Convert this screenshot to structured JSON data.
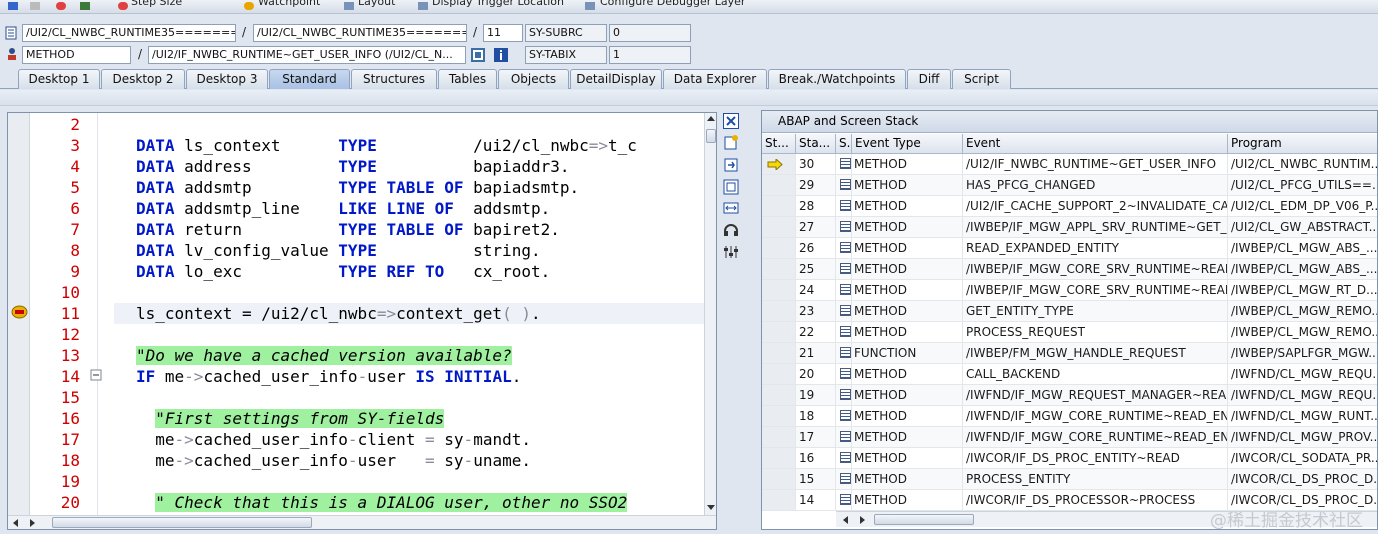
{
  "toolbar": {
    "items": [
      {
        "label": "Step Size"
      },
      {
        "label": "Watchpoint"
      },
      {
        "label": "Layout"
      },
      {
        "label": "Display Trigger Location"
      },
      {
        "label": "Configure Debugger Layer"
      }
    ]
  },
  "fields": {
    "program": "/UI2/CL_NWBC_RUNTIME35=======",
    "include": "/UI2/CL_NWBC_RUNTIME35=======",
    "line": "11",
    "sy_subrc_label": "SY-SUBRC",
    "sy_subrc_value": "0",
    "event_type": "METHOD",
    "event": "/UI2/IF_NWBC_RUNTIME~GET_USER_INFO (/UI2/CL_N...",
    "sy_tabix_label": "SY-TABIX",
    "sy_tabix_value": "1",
    "slash": "/"
  },
  "tabs": [
    {
      "label": "Desktop 1",
      "active": false
    },
    {
      "label": "Desktop 2",
      "active": false
    },
    {
      "label": "Desktop 3",
      "active": false
    },
    {
      "label": "Standard",
      "active": true
    },
    {
      "label": "Structures",
      "active": false
    },
    {
      "label": "Tables",
      "active": false
    },
    {
      "label": "Objects",
      "active": false
    },
    {
      "label": "DetailDisplay",
      "active": false
    },
    {
      "label": "Data Explorer",
      "active": false
    },
    {
      "label": "Break./Watchpoints",
      "active": false
    },
    {
      "label": "Diff",
      "active": false
    },
    {
      "label": "Script",
      "active": false
    }
  ],
  "code": {
    "current_line": 11,
    "lines": [
      {
        "num": "2",
        "tokens": []
      },
      {
        "num": "3",
        "tokens": [
          [
            "kw",
            "DATA"
          ],
          [
            "t",
            " ls_context      "
          ],
          [
            "kw",
            "TYPE"
          ],
          [
            "t",
            "          /ui2/cl_nwbc"
          ],
          [
            "op",
            "=>"
          ],
          [
            "t",
            "t_c"
          ]
        ]
      },
      {
        "num": "4",
        "tokens": [
          [
            "kw",
            "DATA"
          ],
          [
            "t",
            " address         "
          ],
          [
            "kw",
            "TYPE"
          ],
          [
            "t",
            "          bapiaddr3."
          ]
        ]
      },
      {
        "num": "5",
        "tokens": [
          [
            "kw",
            "DATA"
          ],
          [
            "t",
            " addsmtp         "
          ],
          [
            "kw",
            "TYPE TABLE OF"
          ],
          [
            "t",
            " bapiadsmtp."
          ]
        ]
      },
      {
        "num": "6",
        "tokens": [
          [
            "kw",
            "DATA"
          ],
          [
            "t",
            " addsmtp_line    "
          ],
          [
            "kw",
            "LIKE LINE OF"
          ],
          [
            "t",
            "  addsmtp."
          ]
        ]
      },
      {
        "num": "7",
        "tokens": [
          [
            "kw",
            "DATA"
          ],
          [
            "t",
            " return          "
          ],
          [
            "kw",
            "TYPE TABLE OF"
          ],
          [
            "t",
            " bapiret2."
          ]
        ]
      },
      {
        "num": "8",
        "tokens": [
          [
            "kw",
            "DATA"
          ],
          [
            "t",
            " lv_config_value "
          ],
          [
            "kw",
            "TYPE"
          ],
          [
            "t",
            "          string."
          ]
        ]
      },
      {
        "num": "9",
        "tokens": [
          [
            "kw",
            "DATA"
          ],
          [
            "t",
            " lo_exc          "
          ],
          [
            "kw",
            "TYPE REF TO"
          ],
          [
            "t",
            "   cx_root."
          ]
        ]
      },
      {
        "num": "10",
        "tokens": []
      },
      {
        "num": "11",
        "tokens": [
          [
            "t",
            "ls_context = /ui2/cl_nwbc"
          ],
          [
            "op",
            "=>"
          ],
          [
            "t",
            "context_get"
          ],
          [
            "op",
            "( )"
          ],
          [
            "t",
            "."
          ]
        ]
      },
      {
        "num": "12",
        "tokens": []
      },
      {
        "num": "13",
        "tokens": [
          [
            "cmt",
            "\"Do we have a cached version available?"
          ]
        ]
      },
      {
        "num": "14",
        "tokens": [
          [
            "kw",
            "IF"
          ],
          [
            "t",
            " me"
          ],
          [
            "op",
            "->"
          ],
          [
            "t",
            "cached_user_info"
          ],
          [
            "op",
            "-"
          ],
          [
            "t",
            "user "
          ],
          [
            "kw",
            "IS INITIAL"
          ],
          [
            "t",
            "."
          ]
        ]
      },
      {
        "num": "15",
        "tokens": []
      },
      {
        "num": "16",
        "tokens": [
          [
            "t",
            "  "
          ],
          [
            "cmt",
            "\"First settings from SY-fields"
          ]
        ]
      },
      {
        "num": "17",
        "tokens": [
          [
            "t",
            "  me"
          ],
          [
            "op",
            "->"
          ],
          [
            "t",
            "cached_user_info"
          ],
          [
            "op",
            "-"
          ],
          [
            "t",
            "client "
          ],
          [
            "op",
            "="
          ],
          [
            "t",
            " sy"
          ],
          [
            "op",
            "-"
          ],
          [
            "t",
            "mandt."
          ]
        ]
      },
      {
        "num": "18",
        "tokens": [
          [
            "t",
            "  me"
          ],
          [
            "op",
            "->"
          ],
          [
            "t",
            "cached_user_info"
          ],
          [
            "op",
            "-"
          ],
          [
            "t",
            "user   "
          ],
          [
            "op",
            "="
          ],
          [
            "t",
            " sy"
          ],
          [
            "op",
            "-"
          ],
          [
            "t",
            "uname."
          ]
        ]
      },
      {
        "num": "19",
        "tokens": []
      },
      {
        "num": "20",
        "tokens": [
          [
            "t",
            "  "
          ],
          [
            "cmt",
            "\" Check that this is a DIALOG user, other no SSO2"
          ]
        ]
      }
    ]
  },
  "stack": {
    "title": "ABAP and Screen Stack",
    "columns": [
      "St...",
      "Sta...",
      "S...",
      "Event Type",
      "Event",
      "Program"
    ],
    "rows": [
      {
        "st": "30",
        "type": "METHOD",
        "event": "/UI2/IF_NWBC_RUNTIME~GET_USER_INFO",
        "program": "/UI2/CL_NWBC_RUNTIM...",
        "current": true
      },
      {
        "st": "29",
        "type": "METHOD",
        "event": "HAS_PFCG_CHANGED",
        "program": "/UI2/CL_PFCG_UTILS==..."
      },
      {
        "st": "28",
        "type": "METHOD",
        "event": "/UI2/IF_CACHE_SUPPORT_2~INVALIDATE_CA...",
        "program": "/UI2/CL_EDM_DP_V06_P..."
      },
      {
        "st": "27",
        "type": "METHOD",
        "event": "/IWBEP/IF_MGW_APPL_SRV_RUNTIME~GET_...",
        "program": "/UI2/CL_GW_ABSTRACT..."
      },
      {
        "st": "26",
        "type": "METHOD",
        "event": "READ_EXPANDED_ENTITY",
        "program": "/IWBEP/CL_MGW_ABS_..."
      },
      {
        "st": "25",
        "type": "METHOD",
        "event": "/IWBEP/IF_MGW_CORE_SRV_RUNTIME~READ...",
        "program": "/IWBEP/CL_MGW_ABS_..."
      },
      {
        "st": "24",
        "type": "METHOD",
        "event": "/IWBEP/IF_MGW_CORE_SRV_RUNTIME~READ...",
        "program": "/IWBEP/CL_MGW_RT_D..."
      },
      {
        "st": "23",
        "type": "METHOD",
        "event": "GET_ENTITY_TYPE",
        "program": "/IWBEP/CL_MGW_REMO..."
      },
      {
        "st": "22",
        "type": "METHOD",
        "event": "PROCESS_REQUEST",
        "program": "/IWBEP/CL_MGW_REMO..."
      },
      {
        "st": "21",
        "type": "FUNCTION",
        "event": "/IWBEP/FM_MGW_HANDLE_REQUEST",
        "program": "/IWBEP/SAPLFGR_MGW..."
      },
      {
        "st": "20",
        "type": "METHOD",
        "event": "CALL_BACKEND",
        "program": "/IWFND/CL_MGW_REQU..."
      },
      {
        "st": "19",
        "type": "METHOD",
        "event": "/IWFND/IF_MGW_REQUEST_MANAGER~READ...",
        "program": "/IWFND/CL_MGW_REQU..."
      },
      {
        "st": "18",
        "type": "METHOD",
        "event": "/IWFND/IF_MGW_CORE_RUNTIME~READ_EN...",
        "program": "/IWFND/CL_MGW_RUNT..."
      },
      {
        "st": "17",
        "type": "METHOD",
        "event": "/IWFND/IF_MGW_CORE_RUNTIME~READ_EN...",
        "program": "/IWFND/CL_MGW_PROV..."
      },
      {
        "st": "16",
        "type": "METHOD",
        "event": "/IWCOR/IF_DS_PROC_ENTITY~READ",
        "program": "/IWCOR/CL_SODATA_PR..."
      },
      {
        "st": "15",
        "type": "METHOD",
        "event": "PROCESS_ENTITY",
        "program": "/IWCOR/CL_DS_PROC_D..."
      },
      {
        "st": "14",
        "type": "METHOD",
        "event": "/IWCOR/IF_DS_PROCESSOR~PROCESS",
        "program": "/IWCOR/CL_DS_PROC_D..."
      }
    ]
  },
  "watermark": "@稀土掘金技术社区",
  "colors": {
    "keyword": "#0018c8",
    "line_number": "#d00000",
    "comment_bg": "#9ff09f",
    "accent": "#a9c1e4"
  }
}
